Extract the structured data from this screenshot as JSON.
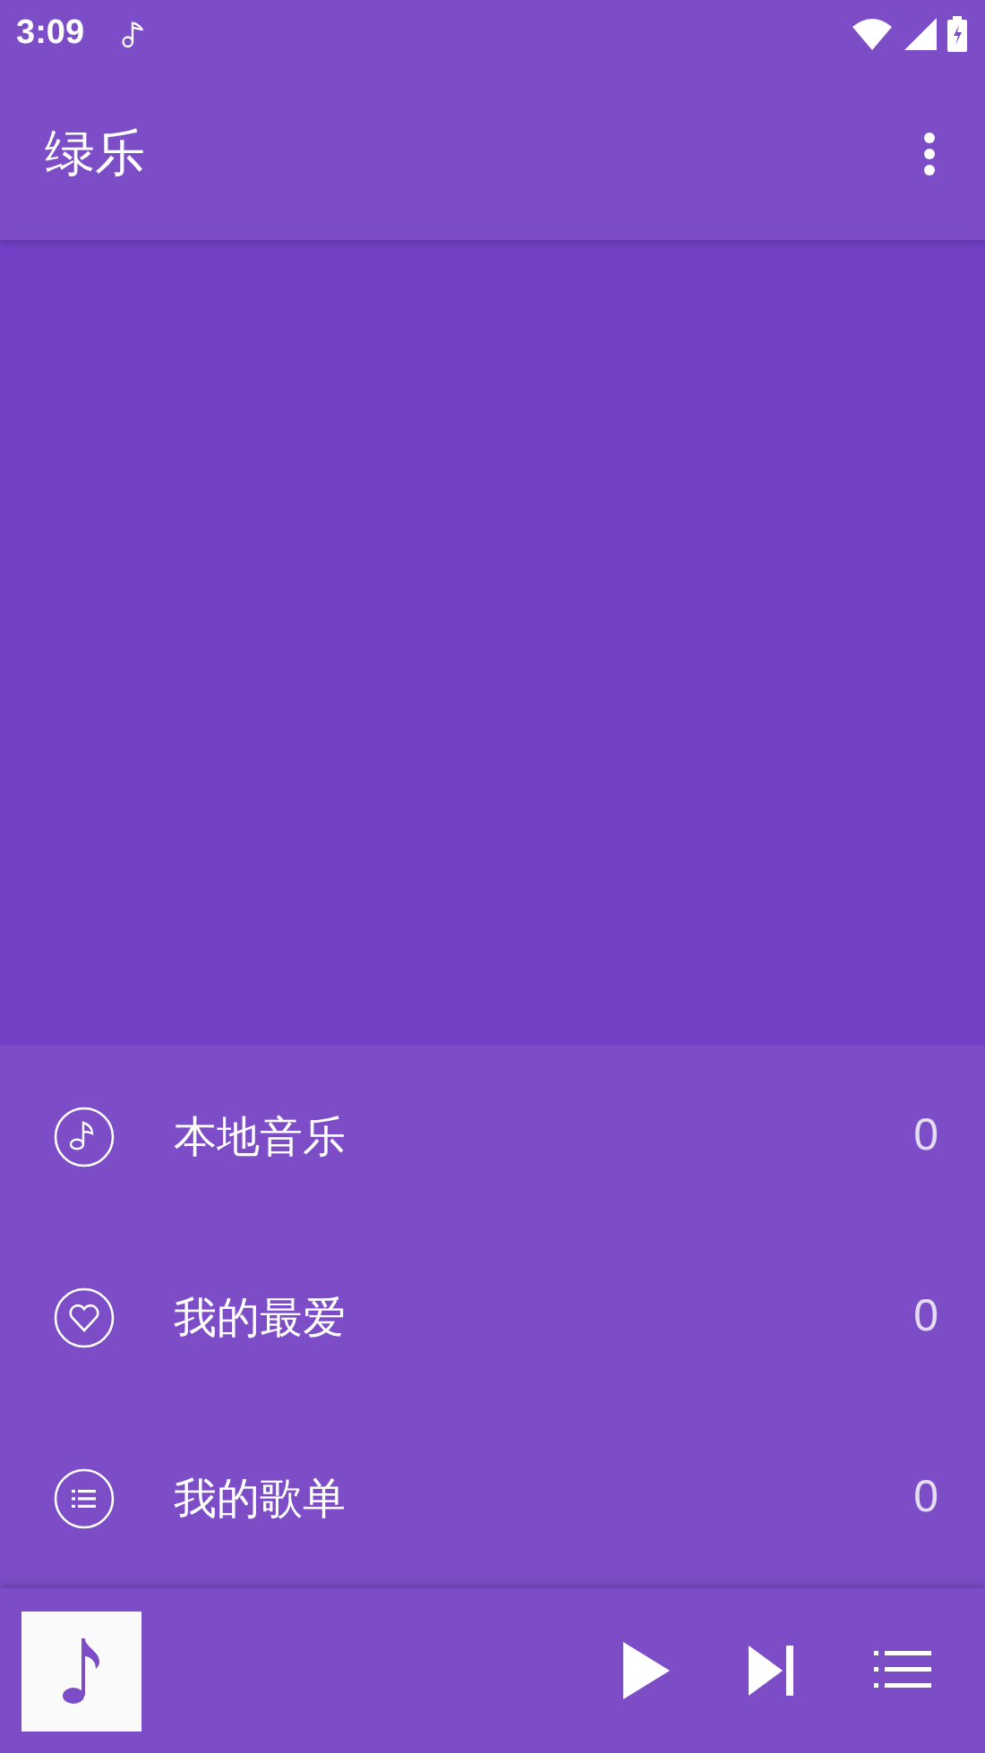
{
  "status_bar": {
    "time": "3:09"
  },
  "app_bar": {
    "title": "绿乐"
  },
  "menu": [
    {
      "kind": "local",
      "label": "本地音乐",
      "count": "0"
    },
    {
      "kind": "favorite",
      "label": "我的最爱",
      "count": "0"
    },
    {
      "kind": "playlist",
      "label": "我的歌单",
      "count": "0"
    }
  ]
}
